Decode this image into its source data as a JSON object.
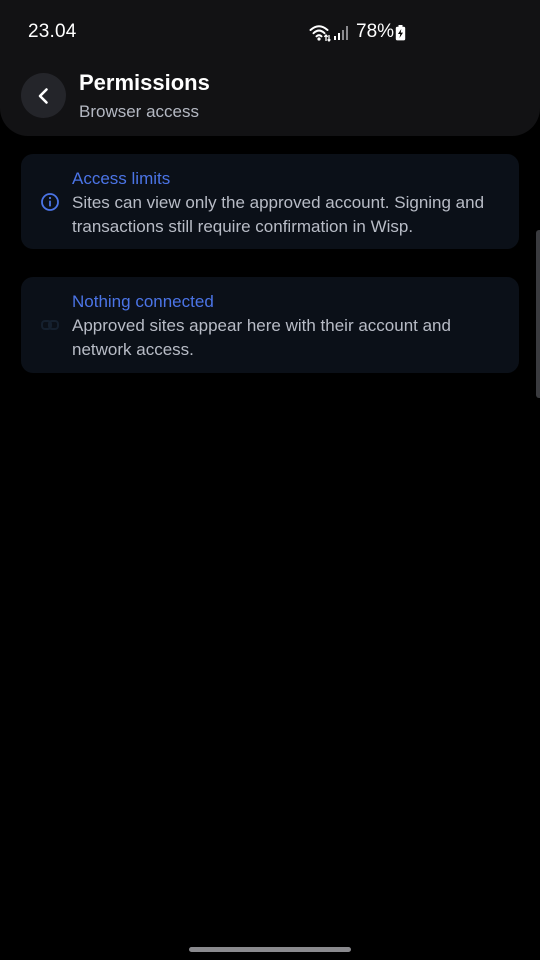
{
  "status_bar": {
    "time": "23.04",
    "battery_percent": "78%",
    "wifi_icon": "wifi-icon",
    "signal_icon": "cell-signal-icon",
    "battery_icon": "battery-charging-icon"
  },
  "header": {
    "back_icon": "chevron-left-icon",
    "title": "Permissions",
    "subtitle": "Browser access"
  },
  "cards": [
    {
      "icon": "info-icon",
      "title": "Access limits",
      "body": "Sites can view only the approved account. Signing and transactions still require confirmation in Wisp."
    },
    {
      "icon": "link-icon",
      "title": "Nothing connected",
      "body": "Approved sites appear here with their account and network access."
    }
  ],
  "colors": {
    "background": "#000000",
    "header_bg": "#121214",
    "card_bg": "#0b1018",
    "accent": "#4b74e6",
    "body_text": "#b8bcc6",
    "subtitle_text": "#b4b8c2"
  }
}
